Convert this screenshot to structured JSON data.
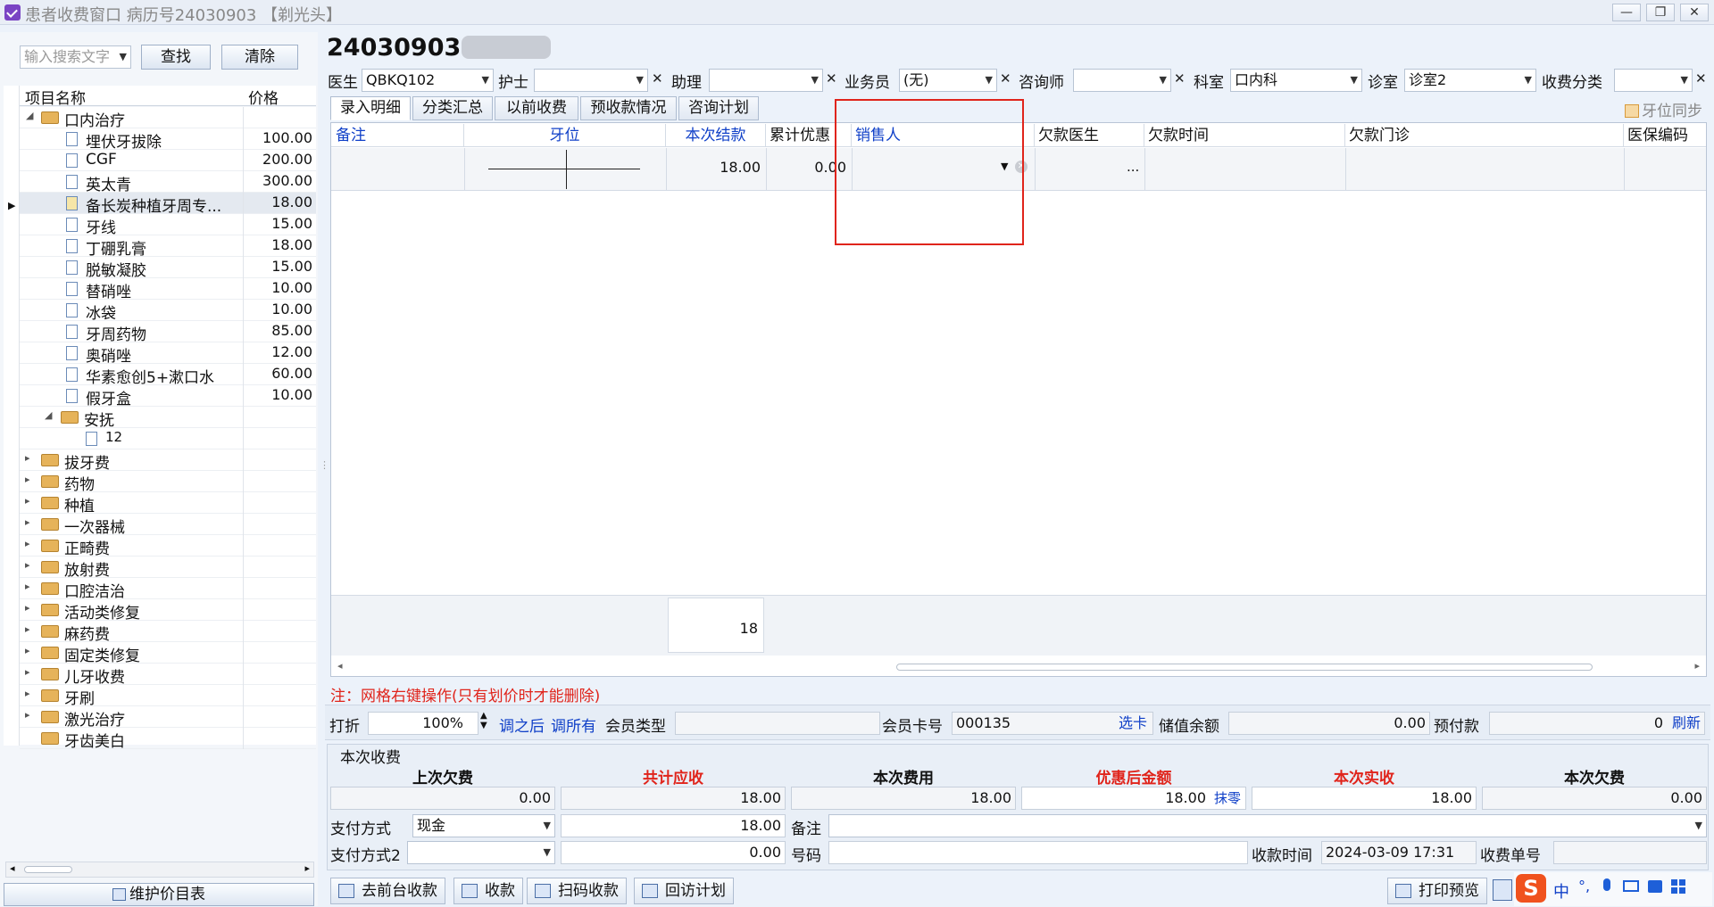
{
  "window": {
    "title": "患者收费窗口    病历号24030903  【剃光头】",
    "controls": [
      "—",
      "❐",
      "✕"
    ]
  },
  "left": {
    "search_placeholder": "输入搜索文字",
    "find_label": "查找",
    "clear_label": "清除",
    "col_name": "项目名称",
    "col_price": "价格",
    "root_folder": "口内治疗",
    "items": [
      {
        "name": "埋伏牙拔除",
        "price": "100.00"
      },
      {
        "name": "CGF",
        "price": "200.00"
      },
      {
        "name": "英太青",
        "price": "300.00"
      },
      {
        "name": "备长炭种植牙周专...",
        "price": "18.00"
      },
      {
        "name": "牙线",
        "price": "15.00"
      },
      {
        "name": "丁硼乳膏",
        "price": "18.00"
      },
      {
        "name": "脱敏凝胶",
        "price": "15.00"
      },
      {
        "name": "替硝唑",
        "price": "10.00"
      },
      {
        "name": "冰袋",
        "price": "10.00"
      },
      {
        "name": "牙周药物",
        "price": "85.00"
      },
      {
        "name": "奥硝唑",
        "price": "12.00"
      },
      {
        "name": "华素愈创5+漱口水",
        "price": "60.00"
      },
      {
        "name": "假牙盒",
        "price": "10.00"
      }
    ],
    "sub_folder": "安抚",
    "sub_item": "12",
    "folders": [
      "拔牙费",
      "药物",
      "种植",
      "一次器械",
      "正畸费",
      "放射费",
      "口腔洁治",
      "活动类修复",
      "麻药费",
      "固定类修复",
      "儿牙收费",
      "牙刷",
      "激光治疗",
      "牙齿美白"
    ],
    "maintain_label": "维护价目表"
  },
  "patient": {
    "record_no": "24030903"
  },
  "selectors": {
    "doctor_label": "医生",
    "doctor_value": "QBKQ102",
    "nurse_label": "护士",
    "nurse_value": "",
    "assistant_label": "助理",
    "assistant_value": "",
    "sales_label": "业务员",
    "sales_value": "(无)",
    "consultant_label": "咨询师",
    "consultant_value": "",
    "dept_label": "科室",
    "dept_value": "口内科",
    "room_label": "诊室",
    "room_value": "诊室2",
    "category_label": "收费分类",
    "category_value": ""
  },
  "tabs": [
    "录入明细",
    "分类汇总",
    "以前收费",
    "预收款情况",
    "咨询计划"
  ],
  "tooth_sync_label": "牙位同步",
  "grid": {
    "headers": [
      "备注",
      "牙位",
      "本次结款",
      "累计优惠",
      "销售人",
      "欠款医生",
      "欠款时间",
      "欠款门诊",
      "医保编码"
    ],
    "row": {
      "payment": "18.00",
      "discount": "0.00",
      "ellipsis": "..."
    },
    "total": "18"
  },
  "note": "注：网格右键操作(只有划价时才能删除)",
  "discount_row": {
    "label": "打折",
    "value": "100%",
    "after_label": "调之后",
    "all_label": "调所有",
    "member_type_label": "会员类型",
    "member_type_value": "",
    "card_label": "会员卡号",
    "card_value": "000135",
    "select_card": "选卡",
    "stored_label": "储值余额",
    "stored_value": "0.00",
    "prepay_label": "预付款",
    "prepay_value": "0",
    "refresh": "刷新"
  },
  "charge": {
    "section_title": "本次收费",
    "headers": [
      "上次欠费",
      "共计应收",
      "本次费用",
      "优惠后金额",
      "本次实收",
      "本次欠费"
    ],
    "values": [
      "0.00",
      "18.00",
      "18.00",
      "18.00",
      "18.00",
      "0.00"
    ],
    "round_label": "抹零",
    "pay_method_label": "支付方式",
    "pay_method_value": "现金",
    "pay_amount": "18.00",
    "remark_label": "备注",
    "remark_value": "",
    "pay_method2_label": "支付方式2",
    "pay_method2_value": "",
    "pay_amount2": "0.00",
    "number_label": "号码",
    "number_value": "",
    "time_label": "收款时间",
    "time_value": "2024-03-09 17:31",
    "receipt_label": "收费单号",
    "receipt_value": ""
  },
  "buttons": {
    "to_front": "去前台收款",
    "collect": "收款",
    "scan": "扫码收款",
    "visit_plan": "回访计划",
    "print_preview": "打印预览"
  },
  "ime": {
    "lang": "中",
    "punct": "°,"
  },
  "colors": {
    "red": "#e0241b",
    "blue": "#1040c8",
    "highlight_box": "#e0241b"
  }
}
